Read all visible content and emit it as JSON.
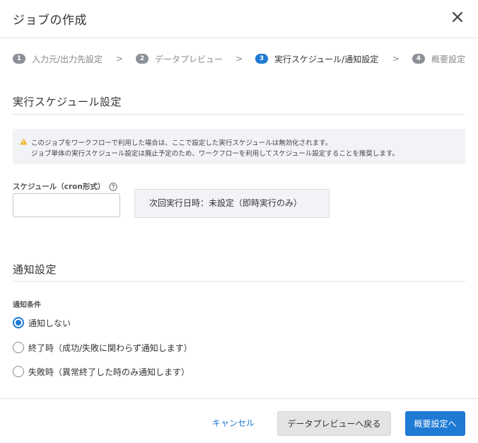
{
  "dialog": {
    "title": "ジョブの作成"
  },
  "steps": [
    {
      "num": "1",
      "label": "入力元/出力先設定",
      "state": "done"
    },
    {
      "num": "2",
      "label": "データプレビュー",
      "state": "done"
    },
    {
      "num": "3",
      "label": "実行スケジュール/通知設定",
      "state": "active"
    },
    {
      "num": "4",
      "label": "概要設定",
      "state": "pending"
    }
  ],
  "step_separator": ">",
  "schedule": {
    "section_title": "実行スケジュール設定",
    "notice_line1": "このジョブをワークフローで利用した場合は、ここで設定した実行スケジュールは無効化されます。",
    "notice_line2": "ジョブ単体の実行スケジュール設定は廃止予定のため、ワークフローを利用してスケジュール設定することを推奨します。",
    "cron_label": "スケジュール（cron形式）",
    "cron_value": "",
    "cron_placeholder": "",
    "next_run_text": "次回実行日時：未設定（即時実行のみ）"
  },
  "notification": {
    "section_title": "通知設定",
    "condition_label": "通知条件",
    "options": [
      {
        "label": "通知しない",
        "checked": true
      },
      {
        "label": "終了時（成功/失敗に関わらず通知します）",
        "checked": false
      },
      {
        "label": "失敗時（異常終了した時のみ通知します）",
        "checked": false
      }
    ]
  },
  "footer": {
    "cancel_label": "キャンセル",
    "back_label": "データプレビューへ戻る",
    "next_label": "概要設定へ"
  },
  "colors": {
    "accent": "#1f7ad4",
    "warning": "#f0b429",
    "step_inactive": "#8c9097"
  },
  "icons": {
    "close": "close-icon",
    "warning": "warning-icon",
    "help": "help-icon"
  }
}
